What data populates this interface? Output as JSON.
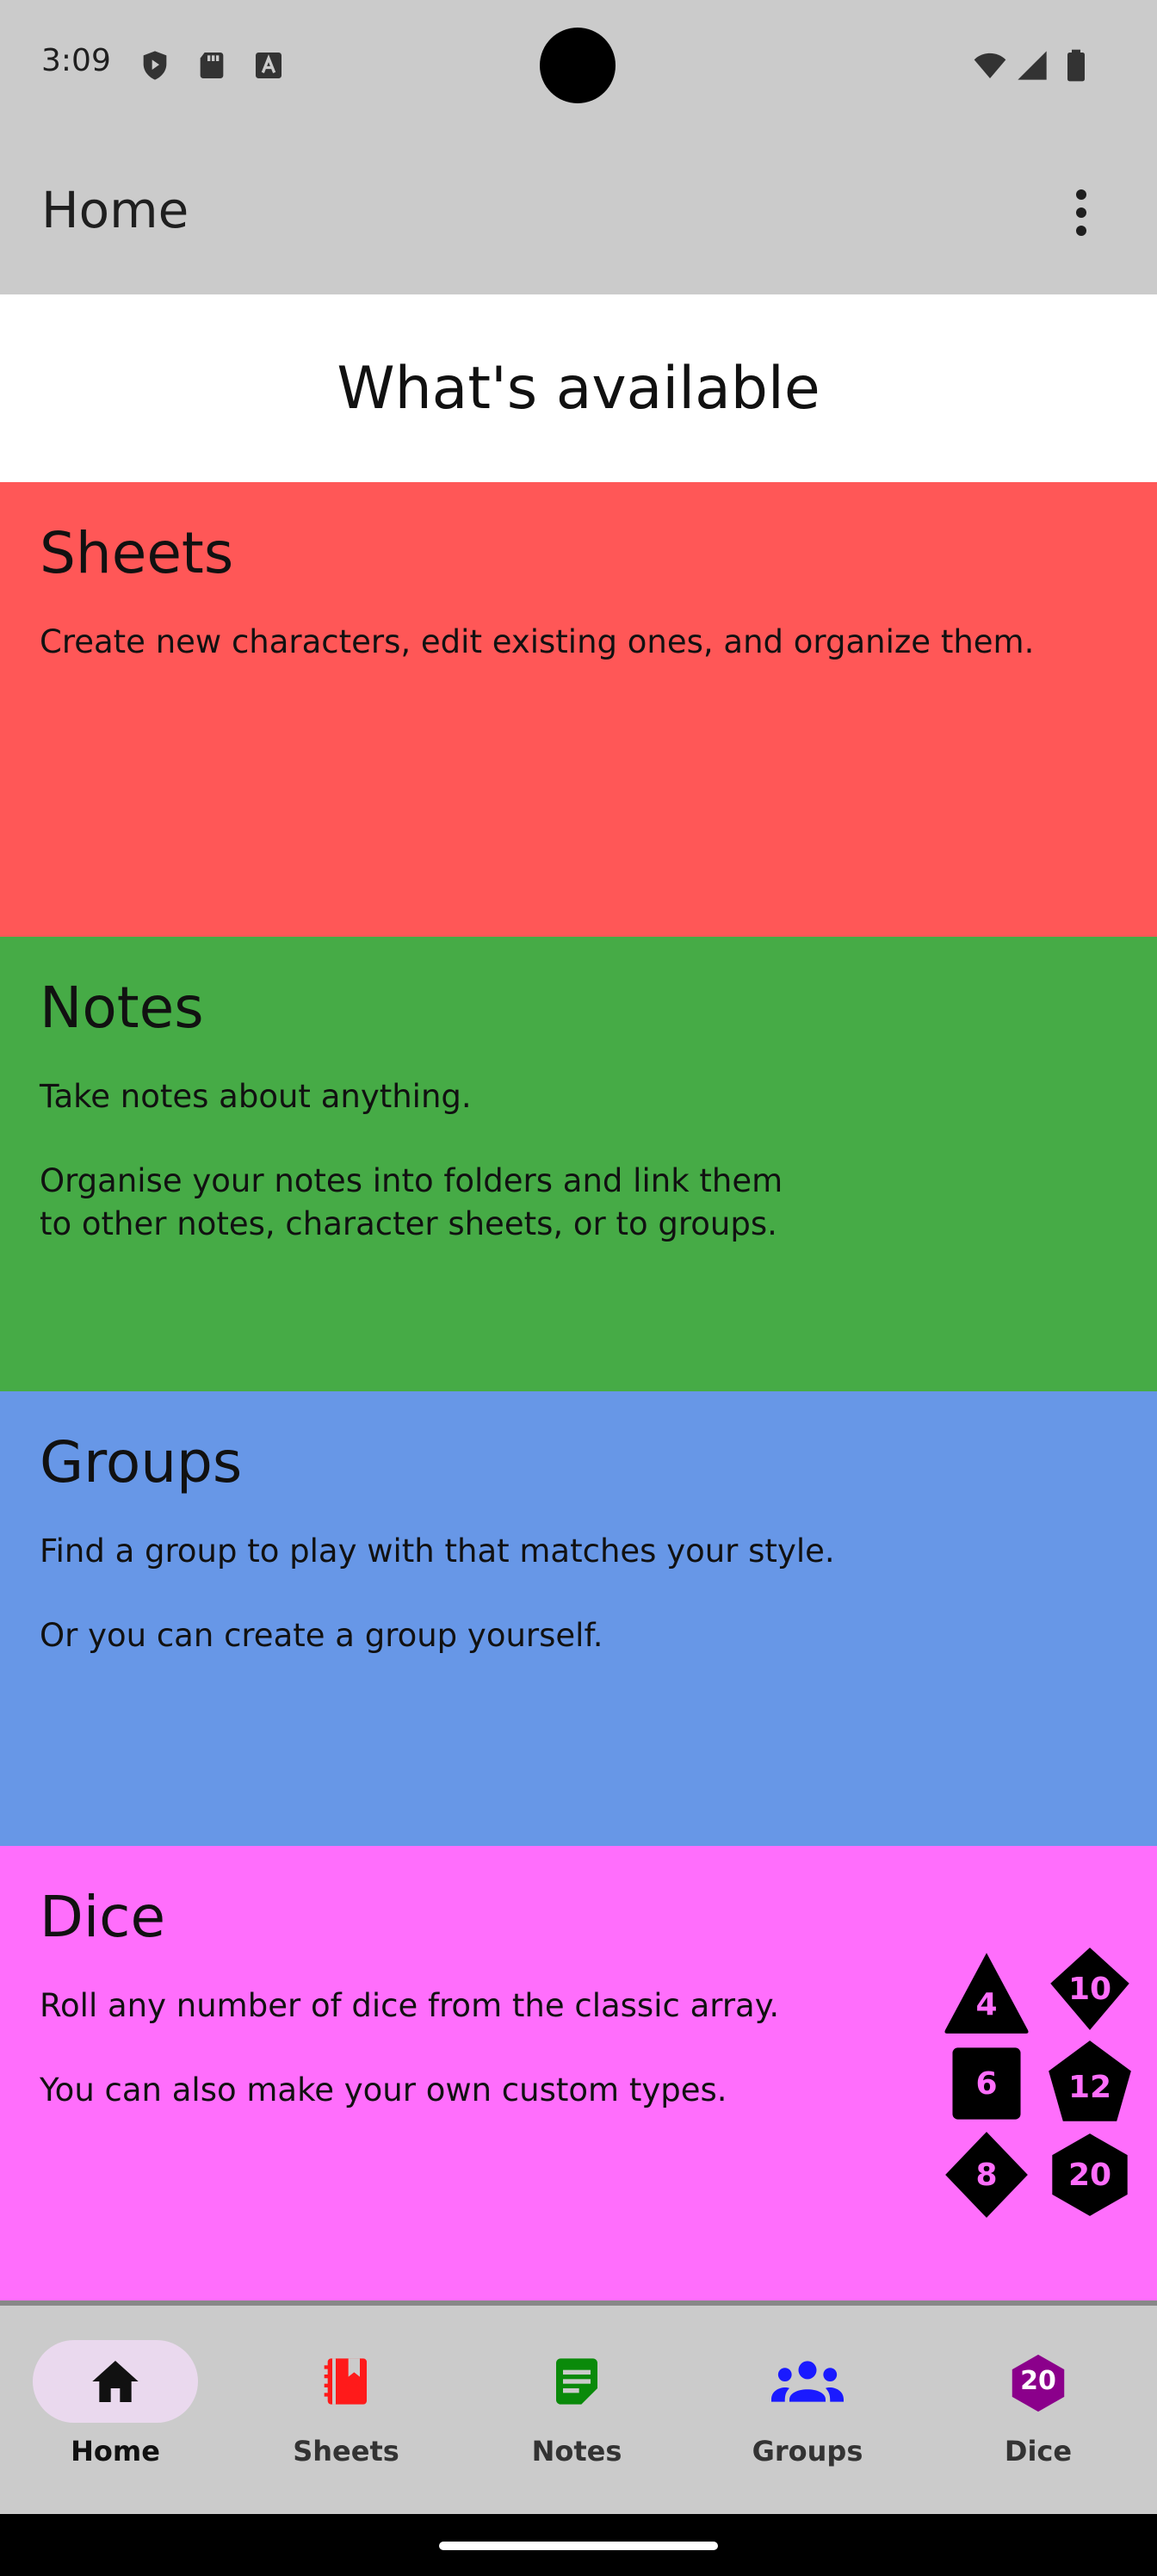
{
  "status_bar": {
    "time": "3:09"
  },
  "app_bar": {
    "title": "Home"
  },
  "section_header": "What's available",
  "cards": {
    "sheets": {
      "title": "Sheets",
      "lines": [
        "Create new characters, edit existing ones, and organize them."
      ]
    },
    "notes": {
      "title": "Notes",
      "lines": [
        "Take notes about anything.",
        "Organise your notes into folders and link them to other notes, character sheets, or to groups."
      ]
    },
    "groups": {
      "title": "Groups",
      "lines": [
        "Find a group to play with that matches your style.",
        "Or you can create a group yourself."
      ]
    },
    "dice": {
      "title": "Dice",
      "lines": [
        "Roll any number of dice from the classic array.",
        "You can also make your own custom types."
      ],
      "dice_icons": [
        "4",
        "10",
        "6",
        "12",
        "8",
        "20"
      ]
    }
  },
  "bottom_nav": {
    "items": [
      {
        "label": "Home",
        "icon": "home-icon",
        "color": "#111111",
        "active": true
      },
      {
        "label": "Sheets",
        "icon": "notebook-icon",
        "color": "#ff1a1a"
      },
      {
        "label": "Notes",
        "icon": "note-icon",
        "color": "#0a8a0a"
      },
      {
        "label": "Groups",
        "icon": "groups-icon",
        "color": "#1a1aff"
      },
      {
        "label": "Dice",
        "icon": "d20-icon",
        "color": "#8b008b",
        "icon_text": "20"
      }
    ]
  },
  "colors": {
    "sheets": "#ff5757",
    "notes": "#46ab46",
    "groups": "#6797e7",
    "dice": "#ff6efc"
  }
}
